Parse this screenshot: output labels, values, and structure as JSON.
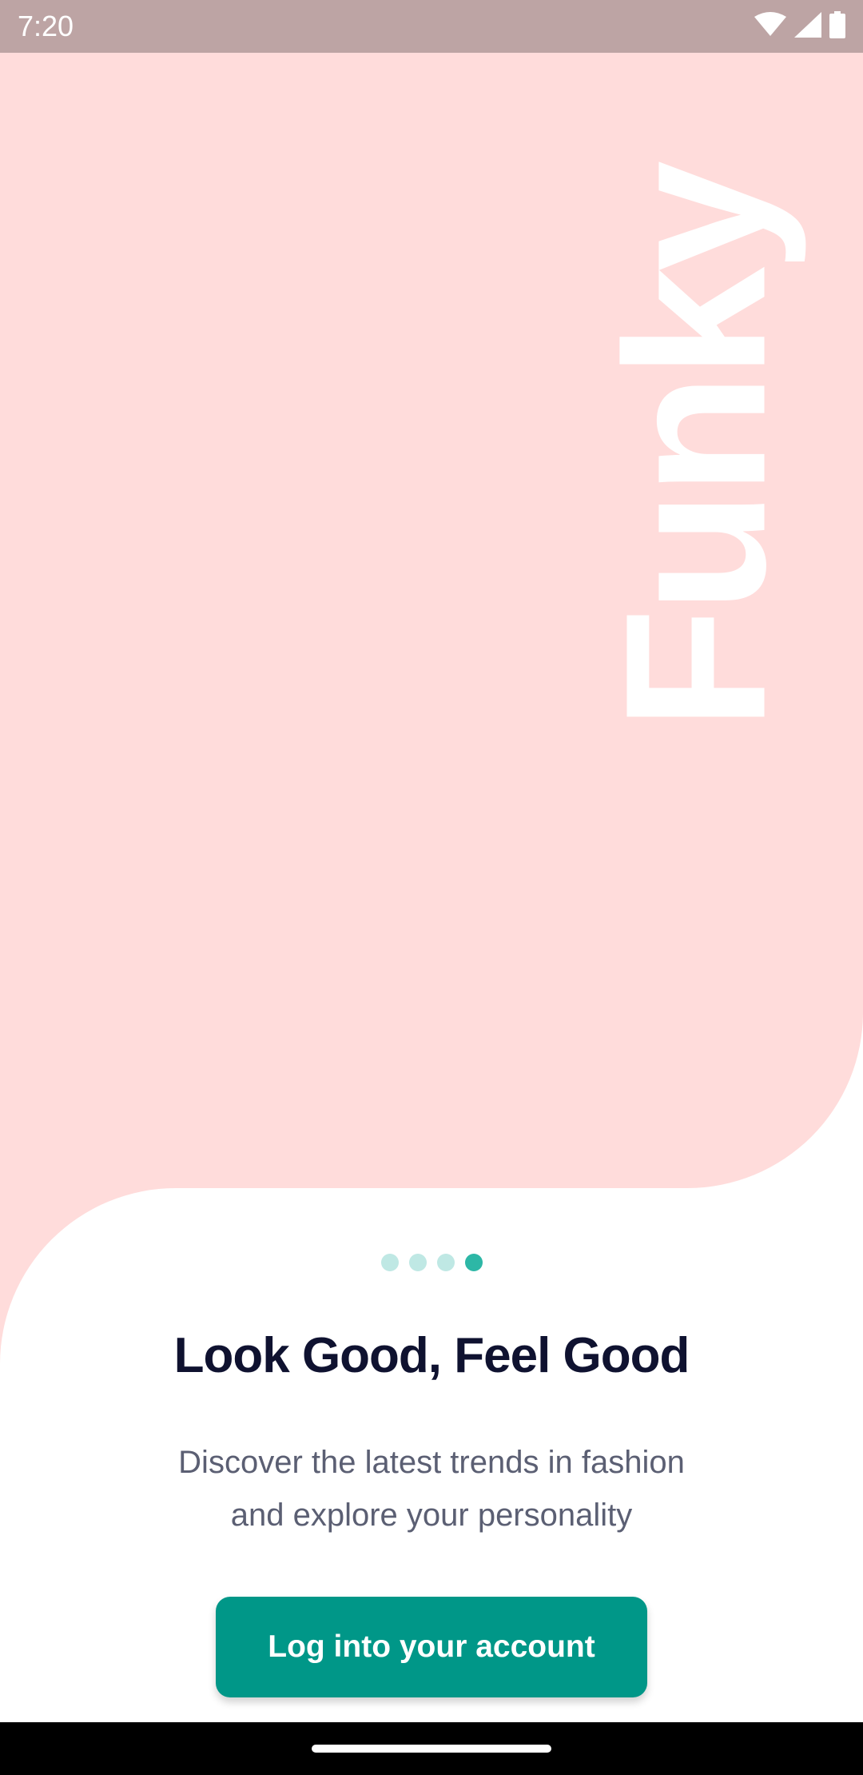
{
  "status_bar": {
    "time": "7:20",
    "icons": [
      "wifi-icon",
      "signal-icon",
      "battery-icon"
    ]
  },
  "hero": {
    "brand": "Funky"
  },
  "pager": {
    "total": 4,
    "active_index": 3
  },
  "content": {
    "headline": "Look Good, Feel Good",
    "subtitle_line1": "Discover the latest trends in fashion",
    "subtitle_line2": "and explore your personality",
    "login_button": "Log into your account"
  },
  "colors": {
    "hero_bg": "#FFDCDB",
    "accent": "#009788",
    "dot_inactive": "#BFE8E4",
    "dot_active": "#2DB7A6",
    "headline": "#0F1230",
    "subtitle": "#5B5F73"
  }
}
